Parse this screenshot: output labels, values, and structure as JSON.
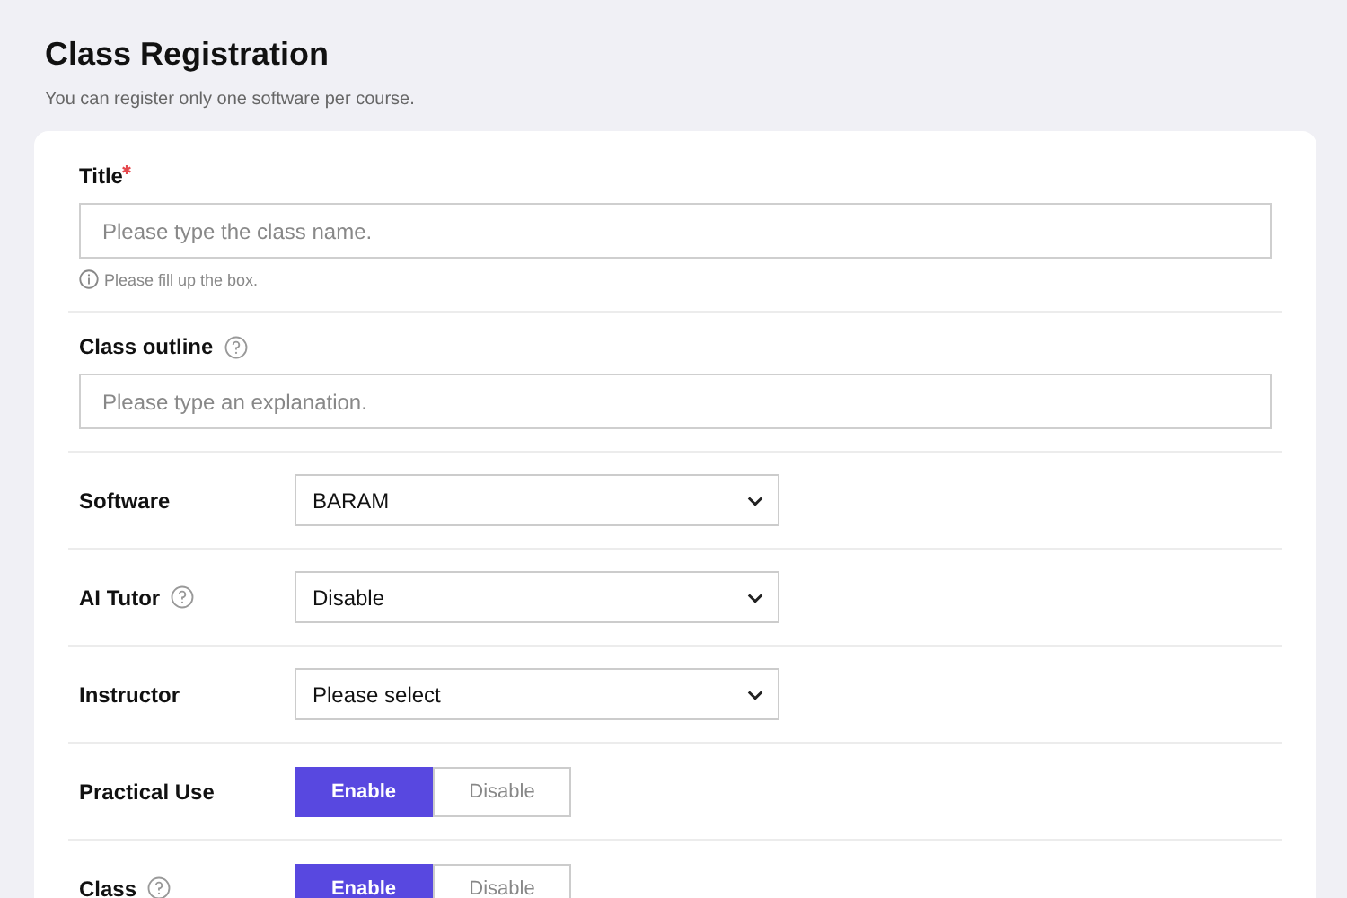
{
  "header": {
    "title": "Class Registration",
    "subtitle": "You can register only one software per course."
  },
  "fields": [
    {
      "kind": "text",
      "label": "Title",
      "required": true,
      "help": false,
      "placeholder": "Please type the class name.",
      "hint": "Please fill up the box."
    },
    {
      "kind": "text",
      "label": "Class outline",
      "required": false,
      "help": true,
      "placeholder": "Please type an explanation."
    },
    {
      "kind": "select",
      "label": "Software",
      "help": false,
      "value": "BARAM"
    },
    {
      "kind": "select",
      "label": "AI Tutor",
      "help": true,
      "value": "Disable"
    },
    {
      "kind": "select",
      "label": "Instructor",
      "help": false,
      "value": "Please select"
    },
    {
      "kind": "toggle",
      "label": "Practical Use",
      "help": false,
      "options": [
        {
          "label": "Enable",
          "selected": true
        },
        {
          "label": "Disable",
          "selected": false
        }
      ]
    },
    {
      "kind": "toggle",
      "label": "Class",
      "help": true,
      "options": [
        {
          "label": "Enable",
          "selected": true
        },
        {
          "label": "Disable",
          "selected": false
        }
      ]
    }
  ]
}
